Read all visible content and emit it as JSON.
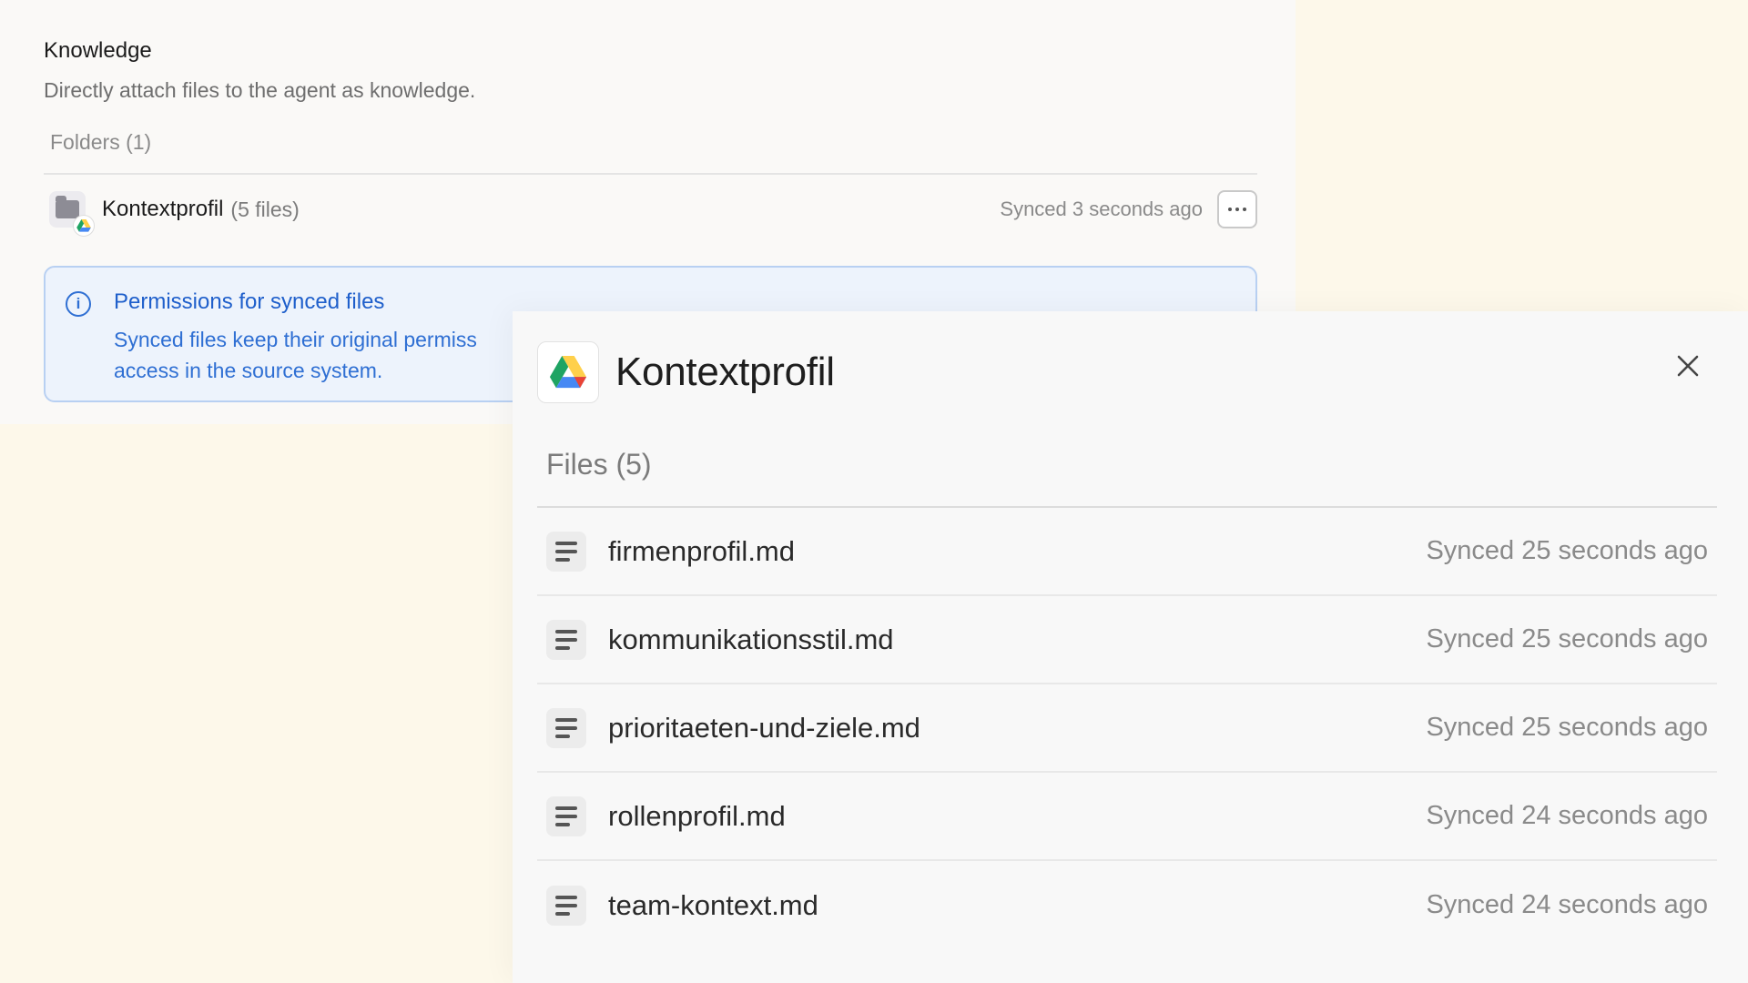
{
  "knowledge": {
    "title": "Knowledge",
    "description": "Directly attach files to the agent as knowledge.",
    "folders_label": "Folders (1)",
    "folder": {
      "name": "Kontextprofil",
      "count": "(5 files)",
      "sync_status": "Synced 3 seconds ago"
    },
    "permissions": {
      "title": "Permissions for synced files",
      "body": "Synced files keep their original permiss",
      "body_line2": "access in the source system."
    }
  },
  "panel": {
    "title": "Kontextprofil",
    "files_label": "Files (5)",
    "files": [
      {
        "name": "firmenprofil.md",
        "sync": "Synced 25 seconds ago"
      },
      {
        "name": "kommunikationsstil.md",
        "sync": "Synced 25 seconds ago"
      },
      {
        "name": "prioritaeten-und-ziele.md",
        "sync": "Synced 25 seconds ago"
      },
      {
        "name": "rollenprofil.md",
        "sync": "Synced 24 seconds ago"
      },
      {
        "name": "team-kontext.md",
        "sync": "Synced 24 seconds ago"
      }
    ]
  },
  "colors": {
    "accent_blue": "#2f6fd3",
    "page_bg": "#fdf8ea",
    "drive_green": "#1fa463",
    "drive_yellow": "#ffd04b",
    "drive_red": "#ea4335",
    "drive_blue": "#4688f4"
  }
}
